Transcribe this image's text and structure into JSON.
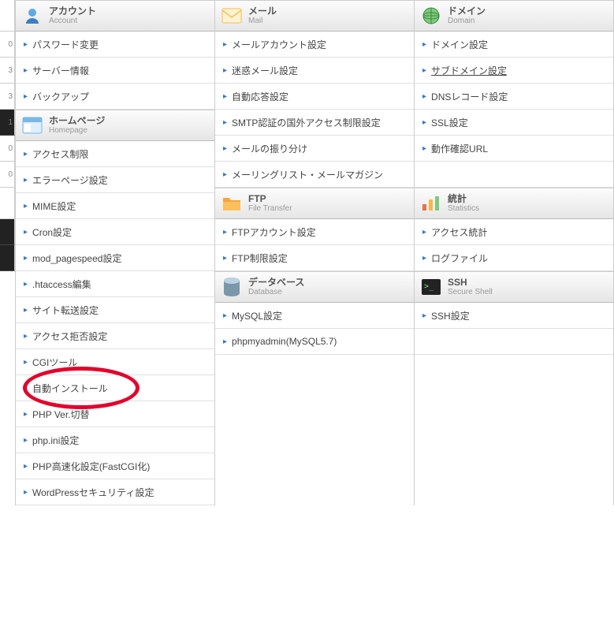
{
  "columns": [
    {
      "sections": [
        {
          "id": "account",
          "title_jp": "アカウント",
          "title_en": "Account",
          "icon": "user-icon",
          "items": [
            {
              "label": "パスワード変更"
            },
            {
              "label": "サーバー情報"
            },
            {
              "label": "バックアップ"
            }
          ]
        },
        {
          "id": "homepage",
          "title_jp": "ホームページ",
          "title_en": "Homepage",
          "icon": "homepage-icon",
          "items": [
            {
              "label": "アクセス制限"
            },
            {
              "label": "エラーページ設定"
            },
            {
              "label": "MIME設定"
            },
            {
              "label": "Cron設定"
            },
            {
              "label": "mod_pagespeed設定"
            },
            {
              "label": ".htaccess編集"
            },
            {
              "label": "サイト転送設定"
            },
            {
              "label": "アクセス拒否設定"
            },
            {
              "label": "CGIツール"
            },
            {
              "label": "自動インストール",
              "circled": true
            },
            {
              "label": "PHP Ver.切替"
            },
            {
              "label": "php.ini設定"
            },
            {
              "label": "PHP高速化設定(FastCGI化)"
            },
            {
              "label": "WordPressセキュリティ設定"
            }
          ]
        }
      ]
    },
    {
      "sections": [
        {
          "id": "mail",
          "title_jp": "メール",
          "title_en": "Mail",
          "icon": "mail-icon",
          "items": [
            {
              "label": "メールアカウント設定"
            },
            {
              "label": "迷惑メール設定"
            },
            {
              "label": "自動応答設定"
            },
            {
              "label": "SMTP認証の国外アクセス制限設定"
            },
            {
              "label": "メールの振り分け"
            },
            {
              "label": "メーリングリスト・メールマガジン"
            }
          ]
        },
        {
          "id": "ftp",
          "title_jp": "FTP",
          "title_en": "File Transfer",
          "icon": "ftp-icon",
          "items": [
            {
              "label": "FTPアカウント設定"
            },
            {
              "label": "FTP制限設定"
            }
          ]
        },
        {
          "id": "database",
          "title_jp": "データベース",
          "title_en": "Database",
          "icon": "database-icon",
          "items": [
            {
              "label": "MySQL設定"
            },
            {
              "label": "phpmyadmin(MySQL5.7)"
            }
          ]
        }
      ]
    },
    {
      "sections": [
        {
          "id": "domain",
          "title_jp": "ドメイン",
          "title_en": "Domain",
          "icon": "domain-icon",
          "items": [
            {
              "label": "ドメイン設定"
            },
            {
              "label": "サブドメイン設定",
              "underline": true
            },
            {
              "label": "DNSレコード設定"
            },
            {
              "label": "SSL設定"
            },
            {
              "label": "動作確認URL"
            },
            {
              "label": "",
              "blank": true
            }
          ]
        },
        {
          "id": "stats",
          "title_jp": "統計",
          "title_en": "Statistics",
          "icon": "stats-icon",
          "items": [
            {
              "label": "アクセス統計"
            },
            {
              "label": "ログファイル"
            }
          ]
        },
        {
          "id": "ssh",
          "title_jp": "SSH",
          "title_en": "Secure Shell",
          "icon": "ssh-icon",
          "items": [
            {
              "label": "SSH設定"
            },
            {
              "label": "",
              "blank": true
            }
          ]
        }
      ]
    }
  ],
  "left_strip": [
    {
      "t": "",
      "hdr": true
    },
    {
      "t": "0"
    },
    {
      "t": "3"
    },
    {
      "t": "3"
    },
    {
      "t": "1",
      "dark": true
    },
    {
      "t": "0"
    },
    {
      "t": "0"
    },
    {
      "t": "",
      "hdr": true
    },
    {
      "t": "",
      "dark": true
    },
    {
      "t": "",
      "dark": true
    }
  ]
}
